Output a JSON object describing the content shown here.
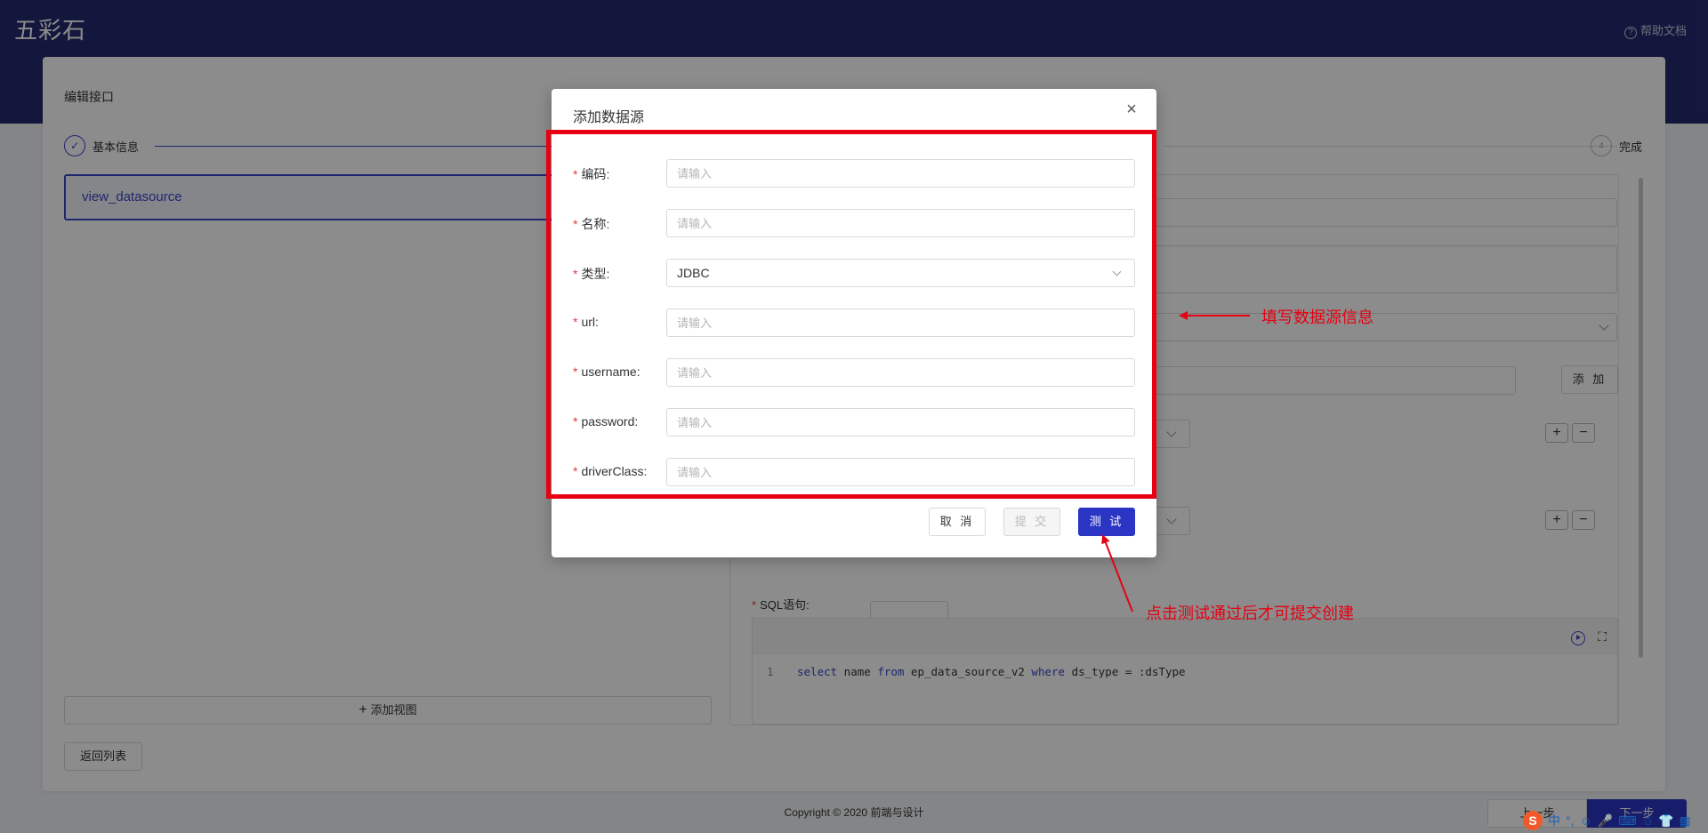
{
  "app": {
    "logo": "五彩石",
    "help": "帮助文档"
  },
  "page": {
    "title": "编辑接口"
  },
  "steps": [
    {
      "num": "✓",
      "label": "基本信息"
    },
    {
      "num": "4",
      "label": "完成"
    }
  ],
  "sidebar": {
    "view_item": "view_datasource",
    "add_view": "添加视图",
    "return": "返回列表"
  },
  "form_bg": {
    "add_label": "添 加",
    "plus": "+",
    "minus": "−"
  },
  "sql": {
    "label": "SQL语句:",
    "line_number": "1",
    "code_parts": [
      {
        "t": "select",
        "kw": true
      },
      {
        "t": " name ",
        "kw": false
      },
      {
        "t": "from",
        "kw": true
      },
      {
        "t": " ep_data_source_v2 ",
        "kw": false
      },
      {
        "t": "where",
        "kw": true
      },
      {
        "t": " ds_type = :dsType",
        "kw": false
      }
    ]
  },
  "nav": {
    "prev": "上一步",
    "next": "下一步"
  },
  "footer": "Copyright © 2020 前端与设计",
  "modal": {
    "title": "添加数据源",
    "close": "×",
    "fields": [
      {
        "label": "编码:",
        "placeholder": "请输入"
      },
      {
        "label": "名称:",
        "placeholder": "请输入"
      },
      {
        "label": "类型:",
        "value": "JDBC"
      },
      {
        "label": "url:",
        "placeholder": "请输入"
      },
      {
        "label": "username:",
        "placeholder": "请输入"
      },
      {
        "label": "password:",
        "placeholder": "请输入"
      },
      {
        "label": "driverClass:",
        "placeholder": "请输入"
      }
    ],
    "buttons": {
      "cancel": "取 消",
      "submit": "提 交",
      "test": "测 试"
    }
  },
  "annotations": {
    "fill_info": "填写数据源信息",
    "test_hint": "点击测试通过后才可提交创建"
  },
  "ime": {
    "s": "S",
    "zh": "中",
    "punct": "°,"
  },
  "colors": {
    "primary": "#2a35c4",
    "header": "#252b6f",
    "annotation_red": "#e60012",
    "required": "#e23c3c"
  }
}
